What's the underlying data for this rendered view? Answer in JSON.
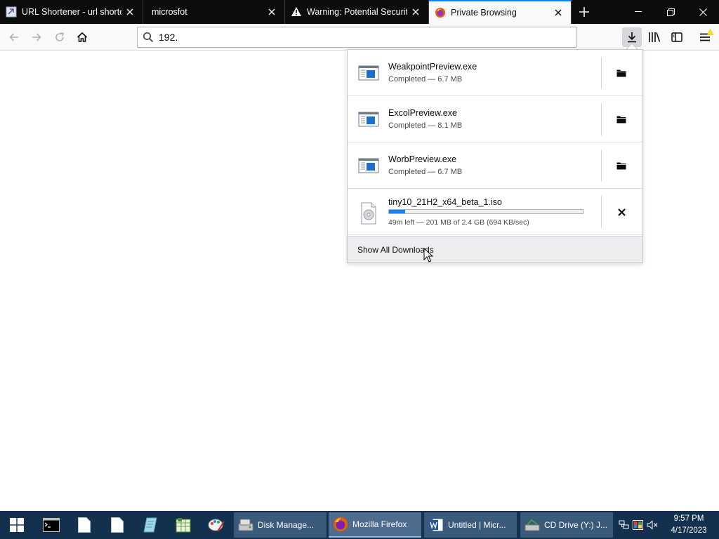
{
  "tabs": [
    {
      "label": "URL Shortener - url shortener",
      "active": false,
      "icon": "url-shortener-favicon"
    },
    {
      "label": "microsfot",
      "active": false,
      "icon": ""
    },
    {
      "label": "Warning: Potential Security Risk",
      "active": false,
      "icon": "warning-icon"
    },
    {
      "label": "Private Browsing",
      "active": true,
      "icon": "firefox-private-icon"
    }
  ],
  "navbar": {
    "url_value": "192.",
    "icons": [
      "back-icon",
      "forward-icon",
      "reload-icon",
      "home-icon",
      "download-icon",
      "library-icon",
      "sidebar-icon",
      "menu-icon"
    ]
  },
  "downloads": {
    "items": [
      {
        "name": "WeakpointPreview.exe",
        "status": "Completed — 6.7 MB",
        "state": "completed",
        "action": "open-folder"
      },
      {
        "name": "ExcolPreview.exe",
        "status": "Completed — 8.1 MB",
        "state": "completed",
        "action": "open-folder"
      },
      {
        "name": "WorbPreview.exe",
        "status": "Completed — 6.7 MB",
        "state": "completed",
        "action": "open-folder"
      },
      {
        "name": "tiny10_21H2_x64_beta_1.iso",
        "status": "49m left — 201 MB of 2.4 GB (694 KB/sec)",
        "state": "downloading",
        "progress": 0.085,
        "action": "cancel"
      }
    ],
    "footer": "Show All Downloads"
  },
  "taskbar": {
    "apps": [
      {
        "label": "Disk Manage...",
        "icon": "disk-management-icon",
        "active": false
      },
      {
        "label": "Mozilla Firefox",
        "icon": "firefox-icon",
        "active": true
      },
      {
        "label": "Untitled | Micr...",
        "icon": "word-icon",
        "active": false
      },
      {
        "label": "CD Drive (Y:) J...",
        "icon": "cd-drive-icon",
        "active": false
      }
    ],
    "time": "9:57 PM",
    "date": "4/17/2023"
  },
  "colors": {
    "accent": "#0a84ff",
    "tabstrip": "#0c0c0d",
    "taskbar": "#14304f"
  }
}
